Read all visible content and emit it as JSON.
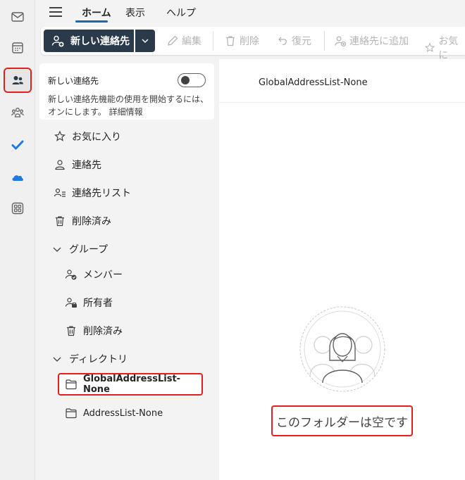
{
  "tabs": {
    "home": "ホーム",
    "view": "表示",
    "help": "ヘルプ"
  },
  "toolbar": {
    "new_contact": "新しい連絡先",
    "edit": "編集",
    "delete": "削除",
    "restore": "復元",
    "add_to_contacts": "連絡先に追加",
    "favorites": "お気に"
  },
  "new_contacts_card": {
    "title": "新しい連絡先",
    "description": "新しい連絡先機能の使用を開始するには、オンにします。 詳細情報",
    "toggle_on": false
  },
  "folders": {
    "favorites": "お気に入り",
    "contacts": "連絡先",
    "contact_lists": "連絡先リスト",
    "deleted": "削除済み",
    "groups": "グループ",
    "members": "メンバー",
    "owners": "所有者",
    "groups_deleted": "削除済み",
    "directory": "ディレクトリ",
    "global_address_list": "GlobalAddressList-None",
    "address_list": "AddressList-None"
  },
  "content": {
    "title": "GlobalAddressList-None",
    "empty_message": "このフォルダーは空です"
  },
  "colors": {
    "accent": "#0f6cbd",
    "primary_button": "#2b3a4a",
    "highlight_border": "#e02020"
  }
}
